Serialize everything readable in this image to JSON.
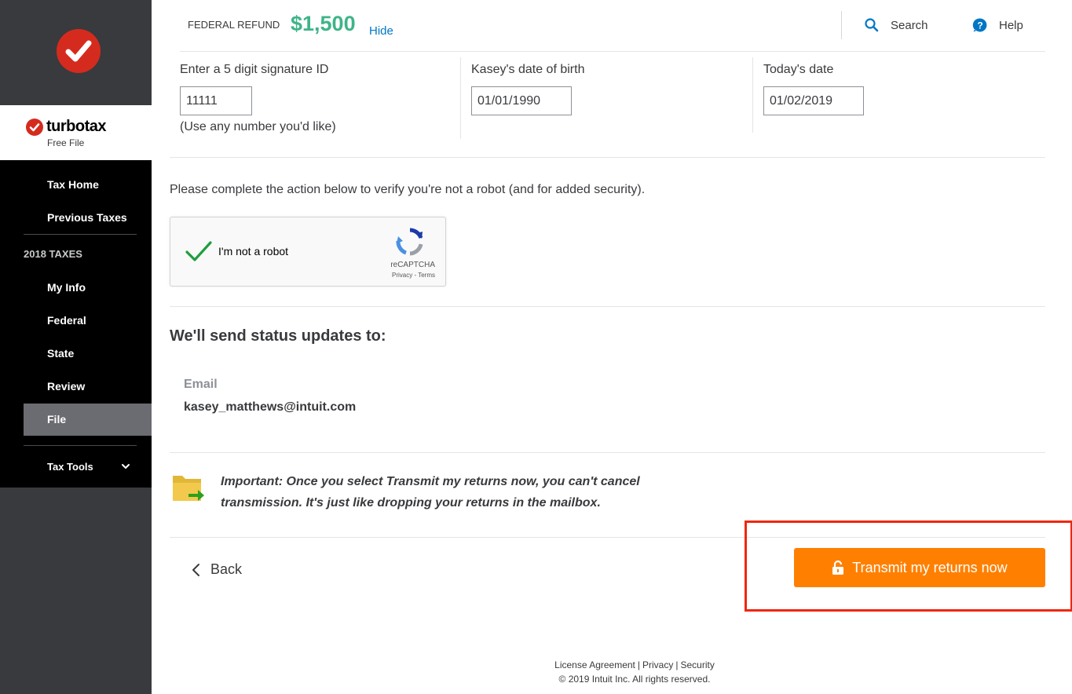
{
  "brand": {
    "name": "turbotax",
    "subtitle": "Free File"
  },
  "sidebar": {
    "items": [
      {
        "label": "Tax Home"
      },
      {
        "label": "Previous Taxes"
      }
    ],
    "section_label": "2018 TAXES",
    "section_items": [
      {
        "label": "My Info"
      },
      {
        "label": "Federal"
      },
      {
        "label": "State"
      },
      {
        "label": "Review"
      },
      {
        "label": "File",
        "active": true
      }
    ],
    "tools_label": "Tax Tools"
  },
  "header": {
    "refund_label": "FEDERAL REFUND",
    "refund_amount": "$1,500",
    "hide_label": "Hide",
    "search_label": "Search",
    "help_label": "Help"
  },
  "form": {
    "signature": {
      "label": "Enter a 5 digit signature ID",
      "value": "11111",
      "note": "(Use any number you'd like)"
    },
    "dob": {
      "label": "Kasey's date of birth",
      "value": "01/01/1990"
    },
    "today": {
      "label": "Today's date",
      "value": "01/02/2019"
    }
  },
  "verify": {
    "text": "Please complete the action below to verify you're not a robot (and for added security).",
    "captcha_label": "I'm not a robot",
    "captcha_brand": "reCAPTCHA",
    "captcha_links": "Privacy - Terms"
  },
  "status": {
    "title": "We'll send status updates to:",
    "email_label": "Email",
    "email_value": "kasey_matthews@intuit.com"
  },
  "important": {
    "text": "Important: Once you select Transmit my returns now, you can't cancel transmission. It's just like dropping your returns in the mailbox."
  },
  "actions": {
    "back_label": "Back",
    "transmit_label": "Transmit my returns now"
  },
  "footer": {
    "license": "License Agreement",
    "privacy": "Privacy",
    "security": "Security",
    "copyright": "© 2019 Intuit Inc. All rights reserved."
  },
  "colors": {
    "accent_green": "#3eb489",
    "link_blue": "#0077c5",
    "cta_orange": "#ff8000",
    "highlight_red": "#f0260f",
    "brand_red": "#d52b1e"
  }
}
